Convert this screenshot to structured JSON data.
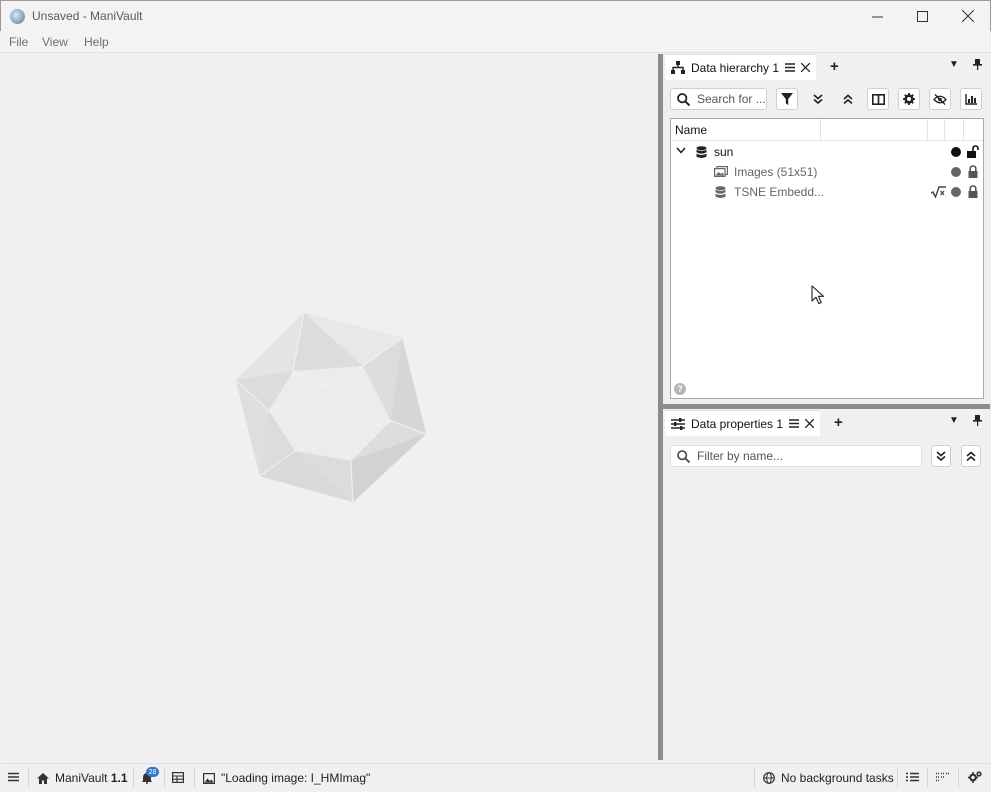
{
  "window": {
    "title": "Unsaved - ManiVault"
  },
  "menubar": {
    "items": [
      "File",
      "View",
      "Help"
    ]
  },
  "hierarchy_panel": {
    "tab_label": "Data hierarchy 1",
    "search_placeholder": "Search for ...",
    "column_name": "Name",
    "rows": [
      {
        "label": "sun",
        "icon": "database-icon",
        "expanded": true,
        "locked": false
      },
      {
        "label": "Images (51x51)",
        "icon": "images-icon",
        "locked": true
      },
      {
        "label": "TSNE Embedd...",
        "icon": "database-icon",
        "locked": true,
        "extra_icon": "square-root-icon"
      }
    ]
  },
  "properties_panel": {
    "tab_label": "Data properties 1",
    "filter_placeholder": "Filter by name..."
  },
  "statusbar": {
    "version_label": "ManiVault",
    "version_number": "1.1",
    "notification_count": "28",
    "loading_text": "\"Loading image: I_HMImag\"",
    "tasks_label": "No background tasks"
  },
  "colors": {
    "splitter": "#8c8c8c",
    "background": "#f0f0f0",
    "badge": "#2e77c6"
  }
}
